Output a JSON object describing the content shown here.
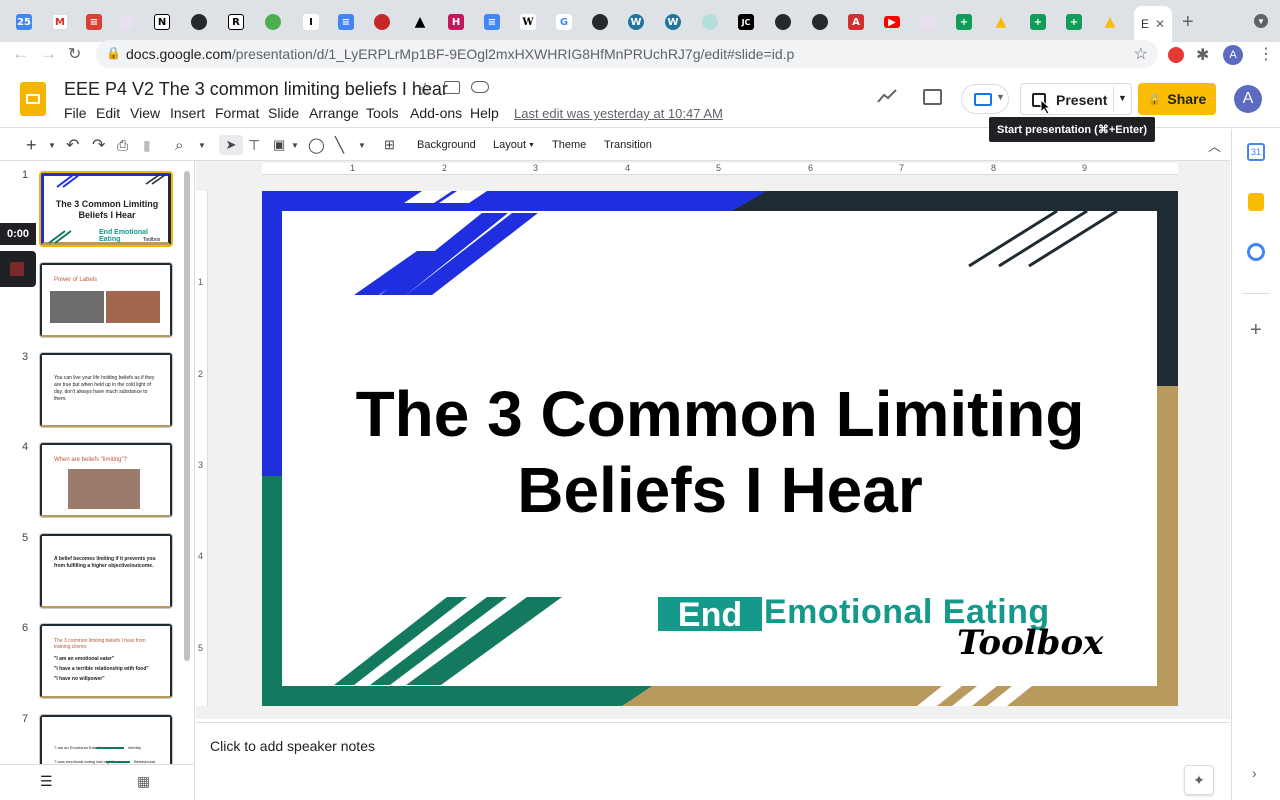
{
  "browser": {
    "active_tab_label": "E",
    "url_domain": "docs.google.com",
    "url_path": "/presentation/d/1_LyERPLrMp1BF-9EOgl2mxHXWHRIG8HfMnPRUchRJ7g/edit#slide=id.p",
    "tab_favicons": [
      "calendar-icon",
      "gmail-icon",
      "todoist-icon",
      "app-icon",
      "notion-icon",
      "github-icon",
      "r-icon",
      "leaf-icon",
      "i-icon",
      "docs-icon",
      "app-icon",
      "cloud-icon",
      "h-icon",
      "docs-icon",
      "wikipedia-icon",
      "google-icon",
      "github-icon",
      "wordpress-icon",
      "wordpress-icon",
      "app-icon",
      "jc-icon",
      "github-icon",
      "github-icon",
      "acrobat-icon",
      "youtube-icon",
      "app-icon",
      "sheets-icon",
      "drive-icon",
      "sheets-icon",
      "sheets-icon",
      "drive-icon"
    ],
    "profile_initial": "A"
  },
  "doc": {
    "title": "EEE P4 V2 The 3 common limiting beliefs I hear",
    "menu": [
      "File",
      "Edit",
      "View",
      "Insert",
      "Format",
      "Slide",
      "Arrange",
      "Tools",
      "Add-ons",
      "Help"
    ],
    "last_edit": "Last edit was yesterday at 10:47 AM",
    "present_label": "Present",
    "share_label": "Share",
    "tooltip": "Start presentation (⌘+Enter)",
    "avatar_initial": "A"
  },
  "toolbar": {
    "background": "Background",
    "layout": "Layout",
    "theme": "Theme",
    "transition": "Transition"
  },
  "ruler": {
    "h": [
      "1",
      "2",
      "3",
      "4",
      "5",
      "6",
      "7",
      "8",
      "9"
    ],
    "v": [
      "1",
      "2",
      "3",
      "4",
      "5"
    ]
  },
  "slide": {
    "title_line1": "The 3 Common Limiting",
    "title_line2": "Beliefs I Hear",
    "logo_end": "End",
    "logo_rest": "Emotional Eating",
    "logo_toolbox": "Toolbox",
    "colors": {
      "blue": "#1f2fe0",
      "dark": "#1f2b33",
      "green": "#137a5f",
      "gold": "#b8995e",
      "teal": "#14998a"
    }
  },
  "notes_placeholder": "Click to add speaker notes",
  "recording": {
    "time": "0:00"
  },
  "thumbnails": [
    {
      "num": "1",
      "title": "The 3 Common Limiting Beliefs I Hear",
      "logo": "End Emotional Eating",
      "logo_sub": "Toolbox"
    },
    {
      "num": "2",
      "title": "Power of Labels"
    },
    {
      "num": "3",
      "body": "You can live your life holding beliefs as if they are true but when held up in the cold light of day, don't always have much substance to them."
    },
    {
      "num": "4",
      "title": "When are beliefs \"limiting\"?"
    },
    {
      "num": "5",
      "body": "A belief becomes limiting if it prevents you from fulfilling a higher objective/outcome."
    },
    {
      "num": "6",
      "title": "The 3 common limiting beliefs I hear from training clients:",
      "lines": [
        "\"I am an emotional eater\"",
        "\"I have a terrible relationship with food\"",
        "\"I have no willpower\""
      ]
    },
    {
      "num": "7",
      "lines": [
        "\"I am an Emotional Eater\"",
        "\"I was emotional eating last night\""
      ],
      "tags": [
        "Identity",
        "Behavioural"
      ]
    }
  ]
}
